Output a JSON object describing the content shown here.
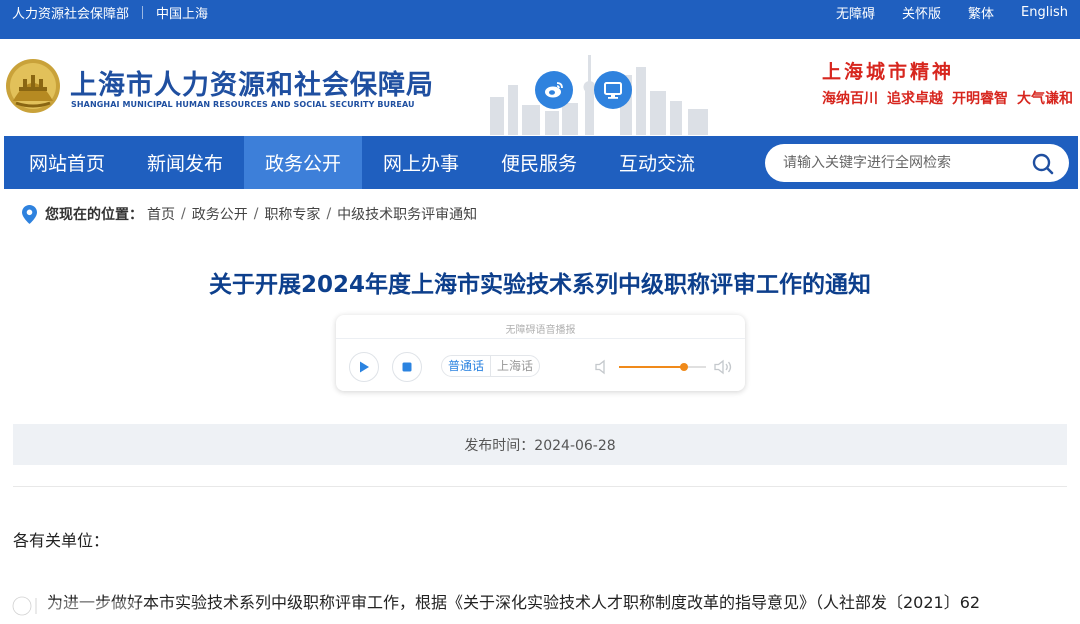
{
  "topbar": {
    "left_links": [
      "人力资源社会保障部",
      "中国上海"
    ],
    "right_links": [
      "无障碍",
      "关怀版",
      "繁体",
      "English"
    ]
  },
  "header": {
    "org_name_cn": "上海市人力资源和社会保障局",
    "org_name_en": "SHANGHAI MUNICIPAL HUMAN RESOURCES AND SOCIAL SECURITY BUREAU",
    "social_icons": [
      "weibo-icon",
      "monitor-icon"
    ],
    "spirit_title": "上海城市精神",
    "spirit_words": [
      "海纳百川",
      "追求卓越",
      "开明睿智",
      "大气谦和"
    ]
  },
  "nav": {
    "items": [
      "网站首页",
      "新闻发布",
      "政务公开",
      "网上办事",
      "便民服务",
      "互动交流"
    ],
    "active": "政务公开",
    "search_placeholder": "请输入关键字进行全网检索"
  },
  "breadcrumb": {
    "label": "您现在的位置：",
    "items": [
      "首页",
      "政务公开",
      "职称专家",
      "中级技术职务评审通知"
    ]
  },
  "article": {
    "title": "关于开展2024年度上海市实验技术系列中级职称评审工作的通知",
    "publish_date": "发布时间：2024-06-28",
    "salutation": "各有关单位：",
    "paragraph_1": "为进一步做好本市实验技术系列中级职称评审工作，根据《关于深化实验技术人才职称制度改革的指导意见》（人社部发〔2021〕62"
  },
  "player": {
    "title": "无障碍语音播报",
    "languages": [
      "普通话",
      "上海话"
    ],
    "selected_language": "普通话",
    "volume": 0.75
  },
  "colors": {
    "primary_blue": "#1f5fbf",
    "active_nav": "#3d7fd9",
    "title_blue": "#0d3f8c",
    "spirit_red": "#d7261e",
    "volume_orange": "#f08a1a"
  }
}
